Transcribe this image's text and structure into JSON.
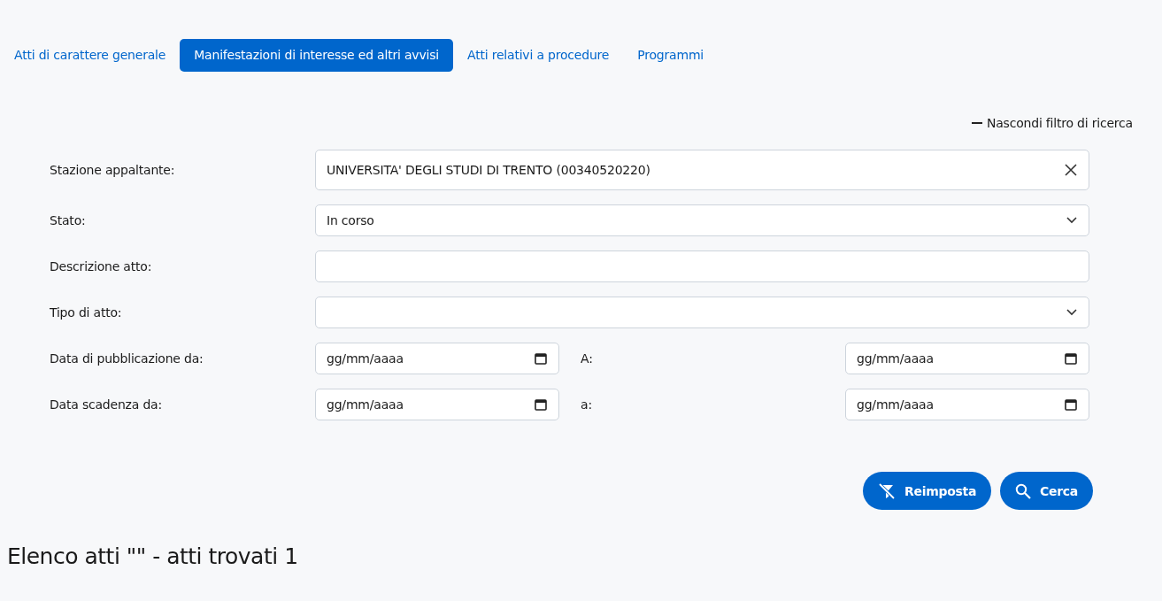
{
  "tabs": [
    {
      "label": "Atti di carattere generale",
      "selected": false
    },
    {
      "label": "Manifestazioni di interesse ed altri avvisi",
      "selected": true
    },
    {
      "label": "Atti relativi a procedure",
      "selected": false
    },
    {
      "label": "Programmi",
      "selected": false
    }
  ],
  "filter_toggle": {
    "label": "Nascondi filtro di ricerca",
    "expanded": true
  },
  "filters": [
    {
      "kind": "clearable",
      "label": "Stazione appaltante:",
      "value": "UNIVERSITA' DEGLI STUDI DI TRENTO (00340520220)"
    },
    {
      "kind": "select",
      "label": "Stato:",
      "value": "In corso"
    },
    {
      "kind": "text",
      "label": "Descrizione atto:"
    },
    {
      "kind": "select",
      "label": "Tipo di atto:"
    },
    {
      "kind": "date_range",
      "label": "Data di pubblicazione da:",
      "from_placeholder": "gg/mm/aaaa",
      "to_label": "A:",
      "to_placeholder": "gg/mm/aaaa"
    },
    {
      "kind": "date_range",
      "label": "Data scadenza da:",
      "from_placeholder": "gg/mm/aaaa",
      "to_label": "a:",
      "to_placeholder": "gg/mm/aaaa"
    }
  ],
  "buttons": [
    {
      "kind": "reset",
      "label": "Reimposta"
    },
    {
      "kind": "search",
      "label": "Cerca"
    }
  ],
  "results_title": "Elenco atti \"\" - atti trovati 1"
}
